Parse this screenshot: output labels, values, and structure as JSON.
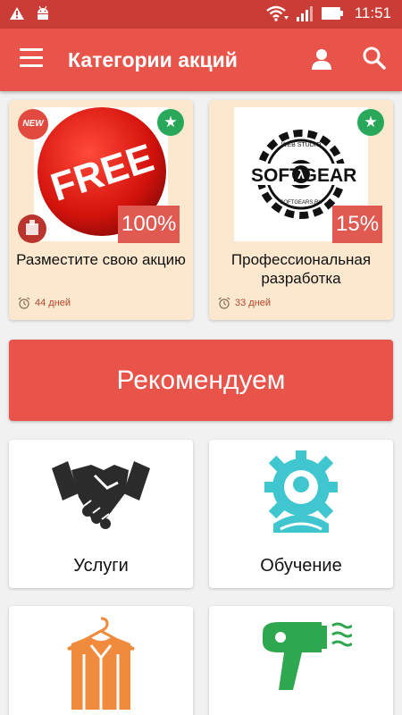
{
  "status_bar": {
    "time": "11:51",
    "icons": [
      "warning-icon",
      "android-icon",
      "wifi-icon",
      "signal-icon",
      "battery-icon"
    ]
  },
  "app_bar": {
    "title": "Категории акций",
    "icons": [
      "menu-icon",
      "user-icon",
      "search-icon"
    ]
  },
  "promos": [
    {
      "title": "Разместите свою акцию",
      "discount": "100%",
      "days": "44 дней",
      "badge": "NEW",
      "image_text": "FREE",
      "icons": [
        "star-icon",
        "alarm-clock-icon"
      ]
    },
    {
      "title": "Профессиональная разработка",
      "discount": "15%",
      "days": "33 дней",
      "image_text": {
        "left": "SOFT",
        "right": "GEAR",
        "top": "WEB STUDIO",
        "bottom": "SOFTGEARS.RU"
      },
      "icons": [
        "star-icon",
        "alarm-clock-icon"
      ]
    }
  ],
  "recommend": {
    "label": "Рекомендуем"
  },
  "categories": [
    {
      "label": "Услуги",
      "icon": "handshake-icon"
    },
    {
      "label": "Обучение",
      "icon": "gear-person-icon"
    },
    {
      "label": "",
      "icon": "clothes-hanger-icon"
    },
    {
      "label": "",
      "icon": "hair-dryer-icon"
    }
  ],
  "colors": {
    "status_bar": "#c93d36",
    "app_bar": "#e8534a",
    "promo_bg": "#fbe8cf",
    "star_badge": "#2aa85a",
    "days_text": "#b0472c",
    "education_icon": "#3fc6cf",
    "clothes_icon": "#f08a3c",
    "dryer_icon": "#2fa74f"
  }
}
